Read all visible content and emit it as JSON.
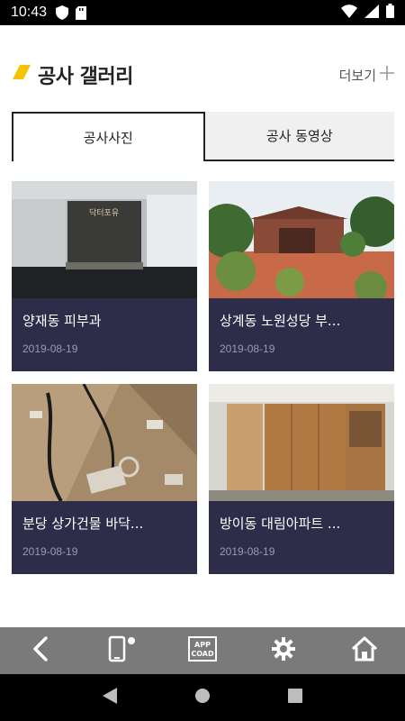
{
  "status_bar": {
    "time": "10:43",
    "icons_left": [
      "shield-icon",
      "sd-card-icon"
    ],
    "icons_right": [
      "wifi-icon",
      "signal-icon",
      "battery-icon"
    ]
  },
  "header": {
    "title": "공사 갤러리",
    "more_label": "더보기",
    "accent_color": "#f5c400"
  },
  "tabs": [
    {
      "label": "공사사진",
      "active": true
    },
    {
      "label": "공사 동영상",
      "active": false
    }
  ],
  "gallery": [
    {
      "title": "양재동 피부과",
      "date": "2019-08-19"
    },
    {
      "title": "상계동 노원성당 부...",
      "date": "2019-08-19"
    },
    {
      "title": "분당 상가건물 바닥...",
      "date": "2019-08-19"
    },
    {
      "title": "방이동 대림아파트 ...",
      "date": "2019-08-19"
    }
  ],
  "thumbnail_sign_text": "닥터포유",
  "bottom_toolbar": {
    "buttons": [
      "back-icon",
      "phone-notify-icon",
      "app-coad-icon",
      "settings-icon",
      "home-icon"
    ],
    "app_label_line1": "APP",
    "app_label_line2": "COAD"
  },
  "nav_bar": {
    "buttons": [
      "nav-back-icon",
      "nav-home-icon",
      "nav-recents-icon"
    ]
  },
  "colors": {
    "card_bg": "#2d2d4a",
    "toolbar_bg": "#7a7a7a",
    "tab_inactive_bg": "#f0f0f0"
  }
}
